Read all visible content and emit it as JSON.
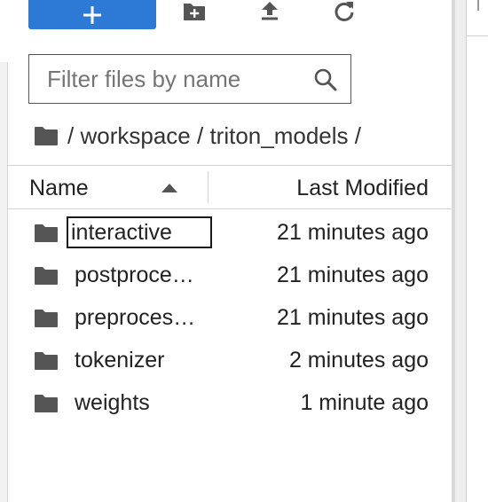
{
  "toolbar": {
    "new_icon": "plus-icon",
    "new_folder_icon": "new-folder-icon",
    "upload_icon": "upload-icon",
    "refresh_icon": "refresh-icon",
    "accent_color": "#2d7ad6"
  },
  "filter": {
    "placeholder": "Filter files by name",
    "value": ""
  },
  "breadcrumb": {
    "root_sep": "/",
    "parts": [
      "workspace",
      "triton_models"
    ],
    "sep": "/"
  },
  "listing": {
    "columns": {
      "name": "Name",
      "modified": "Last Modified",
      "sort": "ascending"
    },
    "items": [
      {
        "name": "interactive",
        "modified": "21 minutes ago",
        "type": "folder",
        "editing": true
      },
      {
        "name": "postprocessing",
        "display": "postproce…",
        "modified": "21 minutes ago",
        "type": "folder"
      },
      {
        "name": "preprocessing",
        "display": "preproces…",
        "modified": "21 minutes ago",
        "type": "folder"
      },
      {
        "name": "tokenizer",
        "modified": "2 minutes ago",
        "type": "folder"
      },
      {
        "name": "weights",
        "modified": "1 minute ago",
        "type": "folder"
      }
    ]
  }
}
